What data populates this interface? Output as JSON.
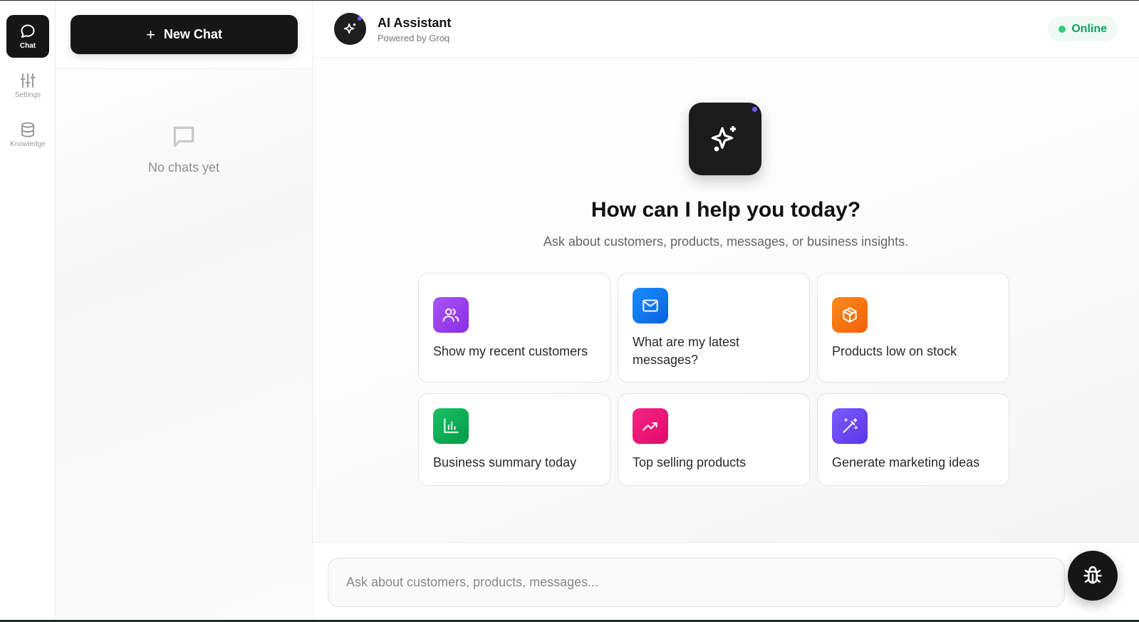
{
  "rail": {
    "items": [
      {
        "label": "Chat",
        "icon": "chat-bubble-icon",
        "active": true
      },
      {
        "label": "Settings",
        "icon": "sliders-icon",
        "active": false
      },
      {
        "label": "Knowledge",
        "icon": "database-icon",
        "active": false
      }
    ]
  },
  "sidebar": {
    "new_chat_label": "New Chat",
    "empty_text": "No chats yet"
  },
  "header": {
    "title": "AI Assistant",
    "subtitle": "Powered by Groq",
    "status": "Online"
  },
  "hero": {
    "title": "How can I help you today?",
    "subtitle": "Ask about customers, products, messages, or business insights."
  },
  "suggestions": [
    {
      "label": "Show my recent customers",
      "icon": "users-icon",
      "color": "#9b3df2"
    },
    {
      "label": "What are my latest messages?",
      "icon": "mail-icon",
      "color": "#1677f0"
    },
    {
      "label": "Products low on stock",
      "icon": "box-icon",
      "color": "#f5720f"
    },
    {
      "label": "Business summary today",
      "icon": "bar-chart-icon",
      "color": "#0fae57"
    },
    {
      "label": "Top selling products",
      "icon": "trending-up-icon",
      "color": "#ec1577"
    },
    {
      "label": "Generate marketing ideas",
      "icon": "magic-wand-icon",
      "color": "#6d49ee"
    }
  ],
  "composer": {
    "placeholder": "Ask about customers, products, messages..."
  },
  "colors": {
    "primary": "#161616",
    "online": "#11a060"
  }
}
